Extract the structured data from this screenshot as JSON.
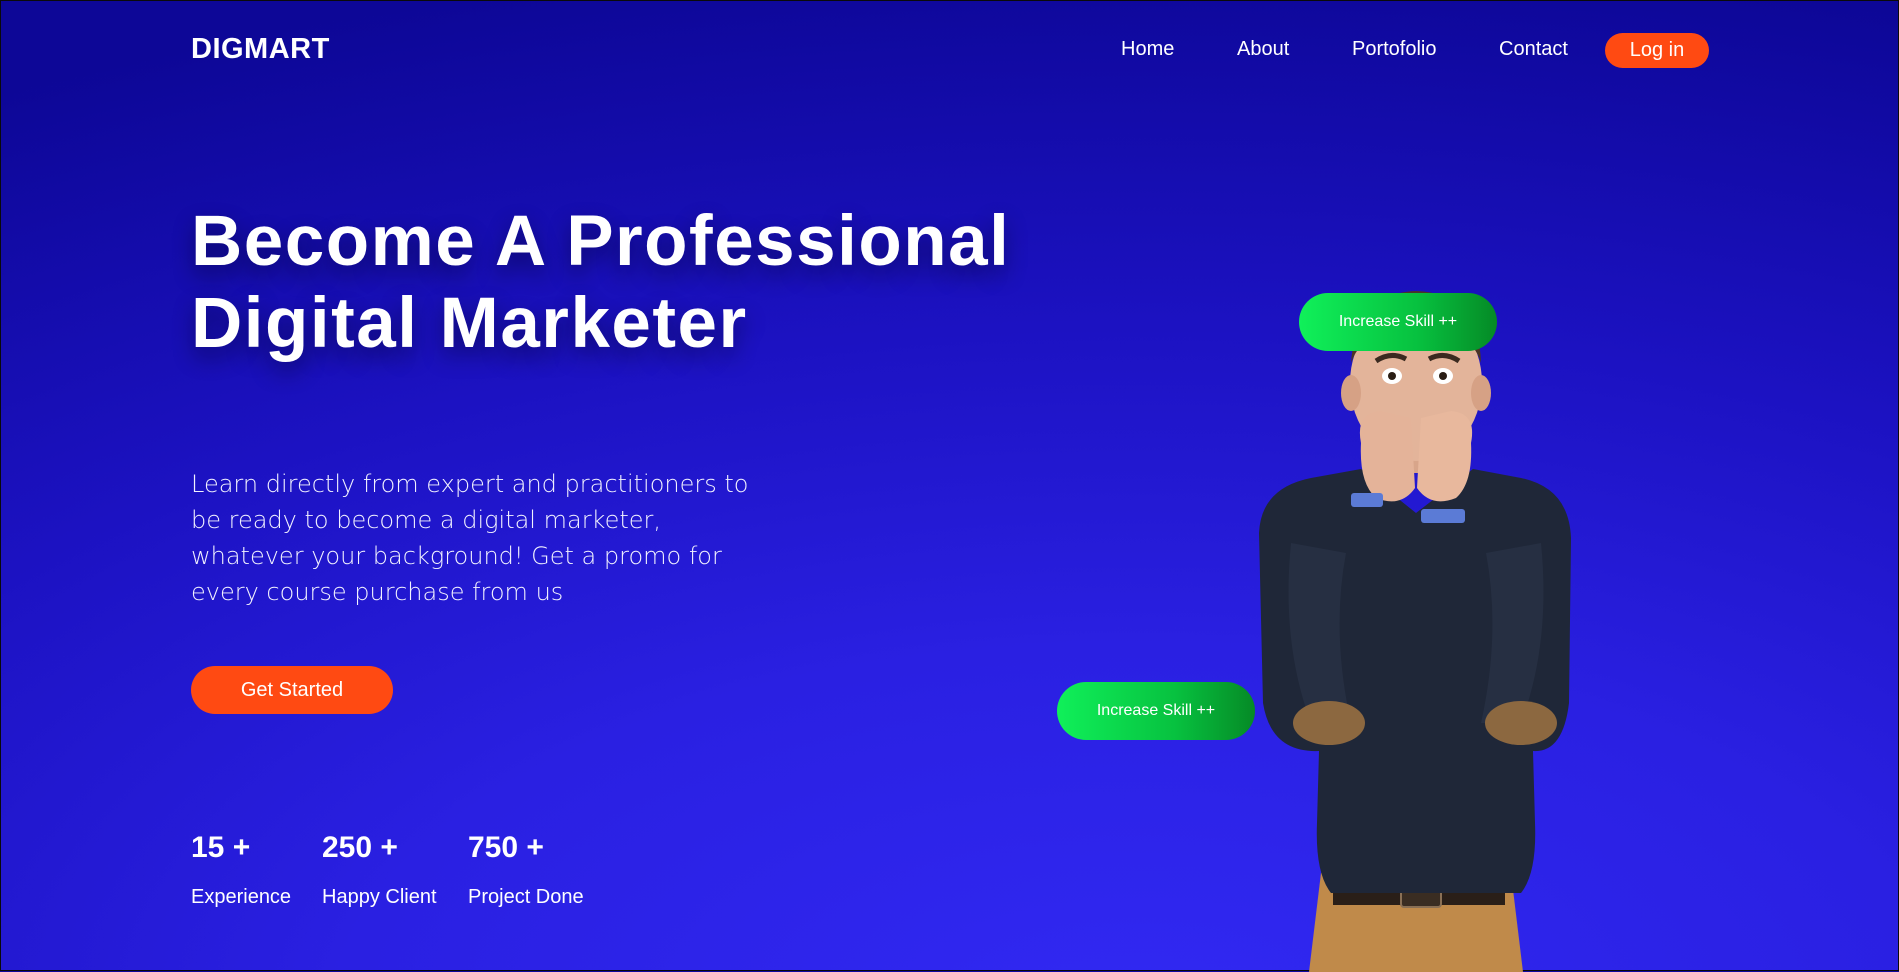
{
  "brand": {
    "logo": "DIGMART"
  },
  "nav": {
    "links": [
      "Home",
      "About",
      "Portofolio",
      "Contact"
    ],
    "login_label": "Log in"
  },
  "hero": {
    "headline_line1": "Become A Professional",
    "headline_line2": "Digital Marketer",
    "description": "Learn directly from expert and practitioners to be ready to become a digital marketer, whatever your background! Get a promo for every course purchase from us",
    "cta_label": "Get Started"
  },
  "stats": [
    {
      "value": "15 +",
      "label": "Experience"
    },
    {
      "value": "250 +",
      "label": "Happy Client"
    },
    {
      "value": "750 +",
      "label": "Project Done"
    }
  ],
  "badges": {
    "top": "Increase Skill ++",
    "bottom": "Increase Skill ++"
  },
  "colors": {
    "accent": "#ff4a12",
    "badge_green": "#10f05a",
    "bg_dark": "#0d0797",
    "bg_light": "#3129f3"
  }
}
